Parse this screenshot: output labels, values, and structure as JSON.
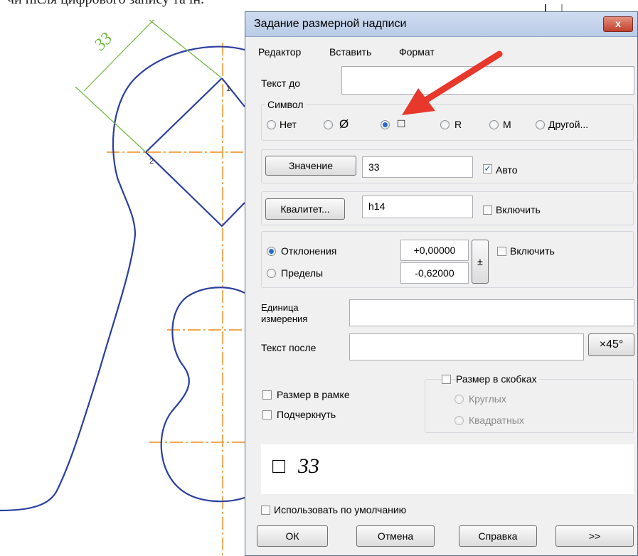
{
  "background": {
    "top_text": "чи після цифрового запису та ін.",
    "dimension_label": "33",
    "point_labels": [
      "1",
      "2"
    ]
  },
  "dialog": {
    "title": "Задание размерной надписи",
    "close_label": "x",
    "menu": [
      "Редактор",
      "Вставить",
      "Формат"
    ],
    "text_before_label": "Текст до",
    "text_before_value": "",
    "symbol": {
      "label": "Символ",
      "options": [
        {
          "label": "Нет",
          "selected": false
        },
        {
          "label": "Ø",
          "selected": false
        },
        {
          "label": "□",
          "selected": true
        },
        {
          "label": "R",
          "selected": false
        },
        {
          "label": "M",
          "selected": false
        },
        {
          "label": "Другой...",
          "selected": false
        }
      ]
    },
    "value": {
      "button": "Значение",
      "field": "33",
      "auto_label": "Авто",
      "auto_checked": true
    },
    "qualitet": {
      "button": "Квалитет...",
      "field": "h14",
      "enable_label": "Включить",
      "enable_checked": false
    },
    "deviations": {
      "option1": "Отклонения",
      "option1_selected": true,
      "option2": "Пределы",
      "option2_selected": false,
      "upper": "+0,00000",
      "lower": "-0,62000",
      "pm_label": "±",
      "enable_label": "Включить",
      "enable_checked": false
    },
    "unit_label_line1": "Единица",
    "unit_label_line2": "измерения",
    "unit_value": "",
    "text_after_label": "Текст после",
    "text_after_value": "",
    "x45_label": "×45°",
    "size_in_frame": "Размер в рамке",
    "underline": "Подчеркнуть",
    "brackets": {
      "label": "Размер в скобках",
      "round": "Круглых",
      "square": "Квадратных"
    },
    "preview": {
      "symbol": "□",
      "text": "33"
    },
    "use_default": "Использовать по умолчанию",
    "buttons": {
      "ok": "ОК",
      "cancel": "Отмена",
      "help": "Справка",
      "more": ">>"
    }
  },
  "colors": {
    "annotation_arrow": "#e8382c",
    "drawing_line": "#2b3f9f",
    "centerline": "#f08a1c",
    "dimension": "#6ab83a"
  }
}
